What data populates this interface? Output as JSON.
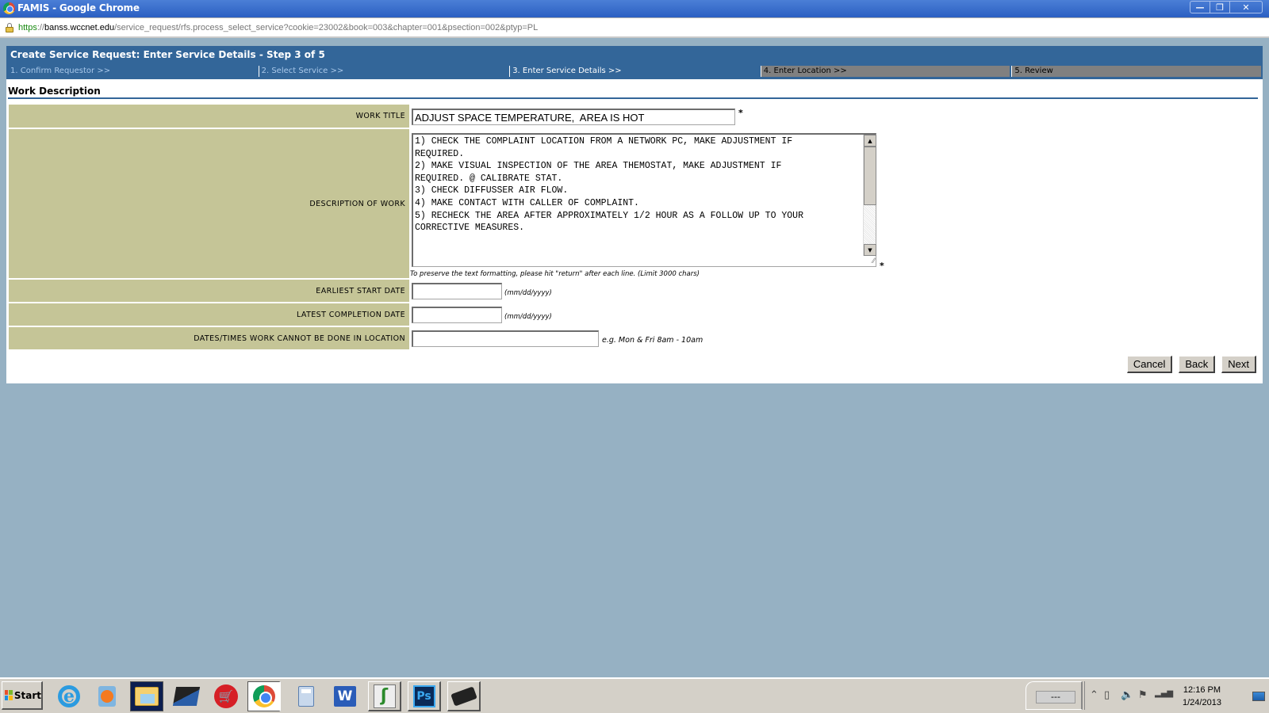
{
  "window": {
    "title": "FAMIS - Google Chrome",
    "controls": {
      "minimize": "—",
      "restore": "❐",
      "close": "✕"
    }
  },
  "address_bar": {
    "scheme": "https",
    "separator": "://",
    "host": "banss.wccnet.edu",
    "path": "/service_request/rfs.process_select_service?cookie=23002&book=003&chapter=001&psection=002&ptyp=PL"
  },
  "page": {
    "header": "Create Service Request: Enter Service Details - Step 3 of 5",
    "steps": [
      {
        "label": "1. Confirm Requestor >>",
        "state": "done"
      },
      {
        "label": "2. Select Service >>",
        "state": "done"
      },
      {
        "label": "3. Enter Service Details >>",
        "state": "current"
      },
      {
        "label": "4. Enter Location >>",
        "state": "todo"
      },
      {
        "label": "5. Review",
        "state": "todo"
      }
    ],
    "section_title": "Work Description",
    "fields": {
      "work_title": {
        "label": "WORK TITLE",
        "value": "ADJUST SPACE TEMPERATURE,  AREA IS HOT",
        "required": "*"
      },
      "description": {
        "label": "DESCRIPTION OF WORK",
        "value": "1) CHECK THE COMPLAINT LOCATION FROM A NETWORK PC, MAKE ADJUSTMENT IF\nREQUIRED.\n2) MAKE VISUAL INSPECTION OF THE AREA THEMOSTAT, MAKE ADJUSTMENT IF\nREQUIRED. @ CALIBRATE STAT.\n3) CHECK DIFFUSSER AIR FLOW.\n4) MAKE CONTACT WITH CALLER OF COMPLAINT.\n5) RECHECK THE AREA AFTER APPROXIMATELY 1/2 HOUR AS A FOLLOW UP TO YOUR\nCORRECTIVE MEASURES.",
        "required": "*",
        "hint": "To preserve the text formatting, please hit \"return\" after each line. (Limit 3000 chars)"
      },
      "earliest_start": {
        "label": "EARLIEST START DATE",
        "value": "",
        "hint": "(mm/dd/yyyy)"
      },
      "latest_completion": {
        "label": "LATEST COMPLETION DATE",
        "value": "",
        "hint": "(mm/dd/yyyy)"
      },
      "cannot_be_done": {
        "label": "DATES/TIMES WORK CANNOT BE DONE IN LOCATION",
        "value": "",
        "hint": "e.g. Mon & Fri 8am - 10am"
      }
    },
    "buttons": {
      "cancel": "Cancel",
      "back": "Back",
      "next": "Next"
    }
  },
  "taskbar": {
    "start_label": "Start",
    "apps": [
      "internet-explorer",
      "windows-media-player",
      "windows-explorer",
      "laptop-app",
      "shopping-cart-app",
      "google-chrome",
      "calculator",
      "microsoft-word",
      "signature-app",
      "photoshop",
      "tablet-app"
    ],
    "language_indicator": "---",
    "tray": {
      "expand": "⌃",
      "battery": "▯",
      "volume": "🔈",
      "flag": "⚑",
      "signal": "▂▄▆"
    },
    "clock": {
      "time": "12:16 PM",
      "date": "1/24/2013"
    }
  }
}
